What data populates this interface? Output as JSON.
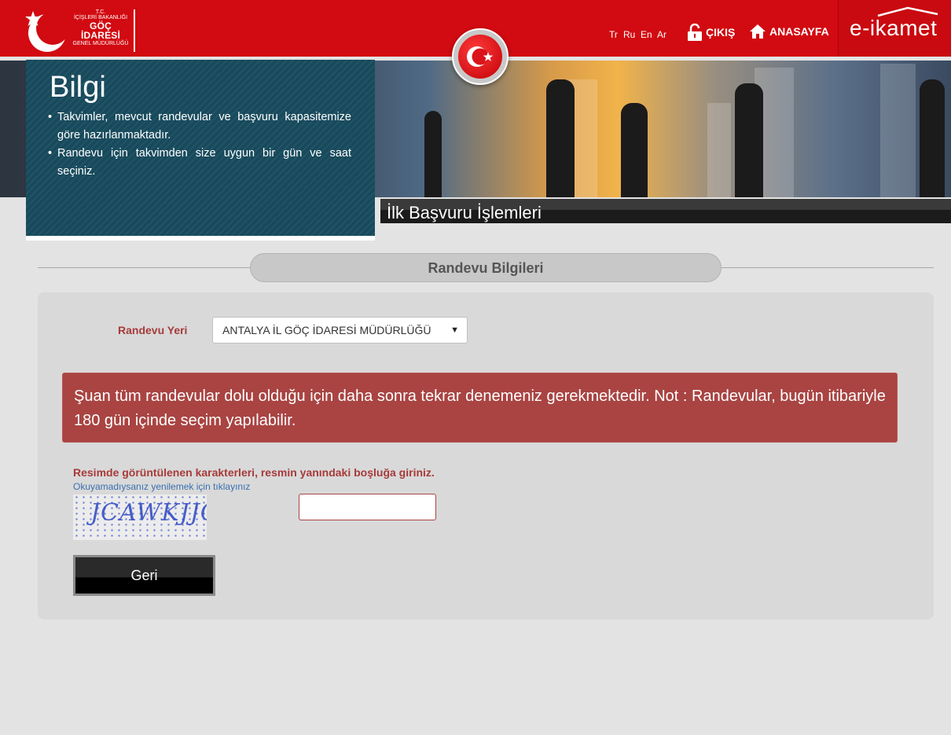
{
  "header": {
    "logo": {
      "tc": "T.C.",
      "line1": "İÇİŞLERİ BAKANLIĞI",
      "line2": "GÖÇ İDARESİ",
      "line3": "GENEL MÜDÜRLÜĞÜ"
    },
    "languages": [
      "Tr",
      "Ru",
      "En",
      "Ar"
    ],
    "logout_label": "ÇIKIŞ",
    "home_label": "ANASAYFA",
    "brand": "e-ikamet",
    "brand_color": "#d20a11"
  },
  "info": {
    "title": "Bilgi",
    "items": [
      "Takvimler, mevcut randevular ve başvuru kapasitemize göre hazırlanmaktadır.",
      "Randevu için takvimden size uygun bir gün ve saat seçiniz."
    ]
  },
  "section_title": "İlk Başvuru İşlemleri",
  "randevu": {
    "heading": "Randevu Bilgileri",
    "location_label": "Randevu Yeri",
    "location_value": "ANTALYA İL GÖÇ İDARESİ MÜDÜRLÜĞÜ",
    "alert": "Şuan tüm randevular dolu olduğu için daha sonra tekrar denemeniz gerekmektedir. Not : Randevular, bugün itibariyle 180 gün içinde seçim yapılabilir.",
    "alert_color": "#a94442",
    "captcha_label": "Resimde görüntülenen karakterleri, resmin yanındaki boşluğa giriniz.",
    "captcha_refresh": "Okuyamadıysanız yenilemek için tıklayınız",
    "captcha_text": "JCAWKJJC",
    "captcha_value": "",
    "back_label": "Geri"
  }
}
